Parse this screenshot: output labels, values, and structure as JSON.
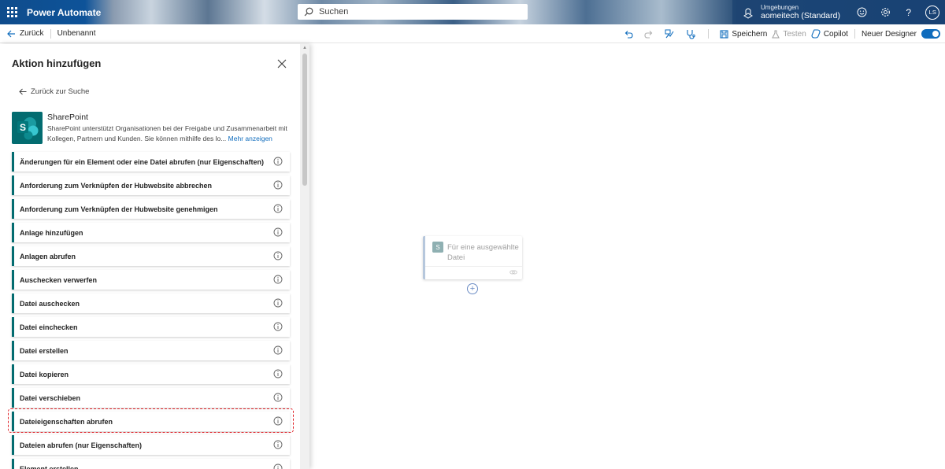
{
  "topbar": {
    "app_name": "Power Automate",
    "search_placeholder": "Suchen",
    "env_label": "Umgebungen",
    "env_value": "aomeitech (Standard)",
    "avatar_initials": "LS",
    "help_label": "?"
  },
  "commandbar": {
    "back_label": "Zurück",
    "flow_name": "Unbenannt",
    "save_label": "Speichern",
    "test_label": "Testen",
    "copilot_label": "Copilot",
    "new_designer_label": "Neuer Designer",
    "new_designer_on": true
  },
  "panel": {
    "title": "Aktion hinzufügen",
    "back_to_search": "Zurück zur Suche",
    "connector_name": "SharePoint",
    "connector_description": "SharePoint unterstützt Organisationen bei der Freigabe und Zusammenarbeit mit Kollegen, Partnern und Kunden. Sie können mithilfe des lo...",
    "show_more": "Mehr anzeigen",
    "actions": [
      "Änderungen für ein Element oder eine Datei abrufen (nur Eigenschaften)",
      "Anforderung zum Verknüpfen der Hubwebsite abbrechen",
      "Anforderung zum Verknüpfen der Hubwebsite genehmigen",
      "Anlage hinzufügen",
      "Anlagen abrufen",
      "Auschecken verwerfen",
      "Datei auschecken",
      "Datei einchecken",
      "Datei erstellen",
      "Datei kopieren",
      "Datei verschieben",
      "Dateieigenschaften abrufen",
      "Dateien abrufen (nur Eigenschaften)",
      "Element erstellen"
    ],
    "highlighted_action": "Dateieigenschaften abrufen"
  },
  "canvas": {
    "trigger_label": "Für eine ausgewählte Datei",
    "add_symbol": "+"
  },
  "colors": {
    "accent": "#0f6cbd",
    "sharepoint": "#036c70",
    "highlight_border": "#e0282e"
  }
}
